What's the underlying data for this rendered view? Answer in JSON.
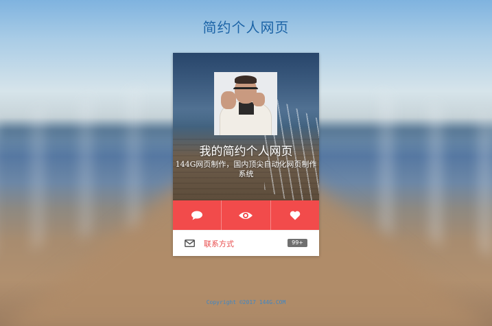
{
  "header": {
    "title": "简约个人网页"
  },
  "profile": {
    "avatar_icon": "person-photo",
    "name": "我的简约个人网页",
    "description": "144G网页制作，国内顶尖自动化网页制作系统"
  },
  "actions": [
    {
      "icon": "comment-icon"
    },
    {
      "icon": "eye-icon"
    },
    {
      "icon": "heart-icon"
    }
  ],
  "contact": {
    "icon": "mail-icon",
    "label": "联系方式",
    "badge": "99+"
  },
  "footer": {
    "text": "Copyright ©2017 144G.COM"
  },
  "colors": {
    "accent": "#f24b4b",
    "title": "#1b63a6",
    "footer": "#3f86c4",
    "badge": "#6f6f6f"
  }
}
